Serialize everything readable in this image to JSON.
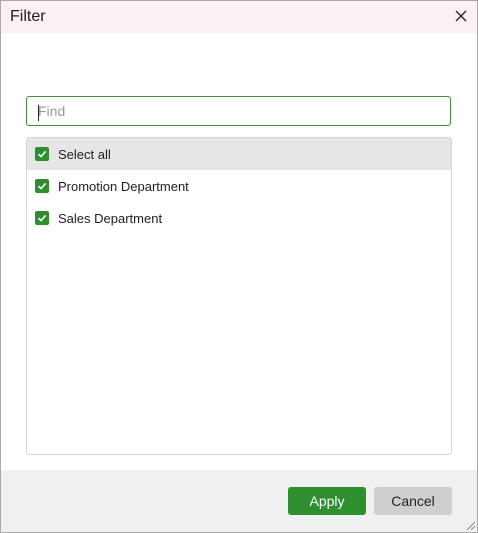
{
  "window": {
    "title": "Filter"
  },
  "search": {
    "placeholder": "Find",
    "value": ""
  },
  "list": {
    "items": [
      {
        "label": "Select all",
        "checked": true
      },
      {
        "label": "Promotion Department",
        "checked": true
      },
      {
        "label": "Sales Department",
        "checked": true
      }
    ]
  },
  "footer": {
    "apply_label": "Apply",
    "cancel_label": "Cancel"
  },
  "icons": {
    "close": "close-icon",
    "check": "checkmark-icon",
    "resize": "resize-grip-icon"
  },
  "colors": {
    "accent": "#2d8f2d",
    "title_bar": "#fbf0f4",
    "footer": "#f0f0f0",
    "highlight": "#e6e6e6"
  }
}
